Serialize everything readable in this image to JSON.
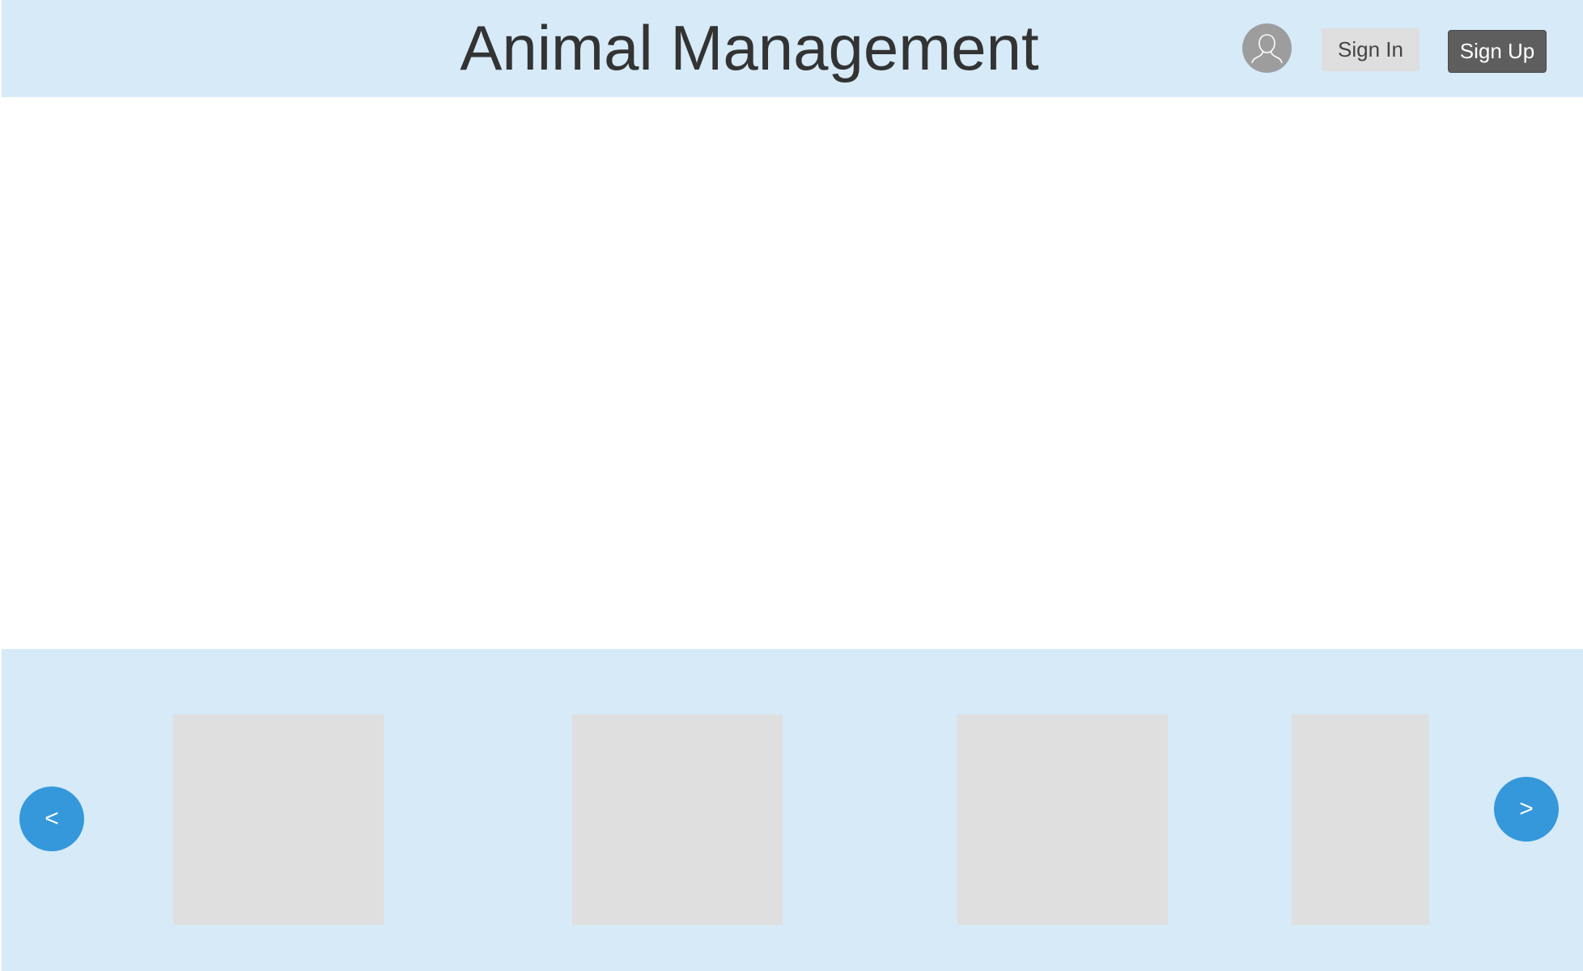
{
  "header": {
    "title": "Animal Management",
    "avatar_icon": "user-avatar-icon",
    "sign_in_label": "Sign In",
    "sign_up_label": "Sign Up"
  },
  "carousel": {
    "prev_label": "<",
    "next_label": ">",
    "slides": [
      "",
      "",
      "",
      ""
    ]
  },
  "colors": {
    "header_bg": "#d6eaf8",
    "carousel_bg": "#d6eaf8",
    "accent": "#3498db",
    "sign_up_bg": "#5e5e5e",
    "sign_in_bg": "#dedede",
    "placeholder": "#dfdfdf"
  }
}
